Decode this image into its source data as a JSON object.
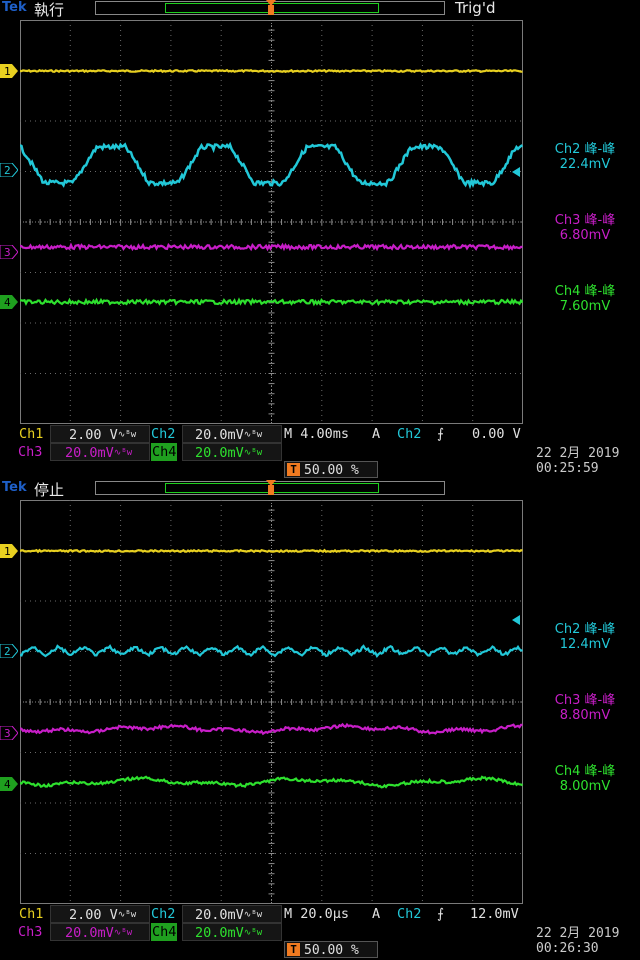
{
  "colors": {
    "ch1": "#e8d020",
    "ch2": "#22c8d8",
    "ch3": "#c81ec8",
    "ch4": "#2ee02e",
    "trigger": "#f07a20",
    "grid": "#6a6a6a",
    "brand": "#1e5fc8"
  },
  "captures": [
    {
      "brand": "Tek",
      "state": "執行",
      "trig_status": "Trig'd",
      "markers": [
        "1",
        "2",
        "3",
        "4"
      ],
      "measurements": [
        {
          "label": "Ch2 峰-峰",
          "value": "22.4mV"
        },
        {
          "label": "Ch3 峰-峰",
          "value": "6.80mV"
        },
        {
          "label": "Ch4 峰-峰",
          "value": "7.60mV"
        }
      ],
      "info": {
        "ch1_label": "Ch1",
        "ch1_scale": "2.00 V",
        "ch2_label": "Ch2",
        "ch2_scale": "20.0mV",
        "ch3_label": "Ch3",
        "ch3_scale": "20.0mV",
        "ch4_label": "Ch4",
        "ch4_scale": "20.0mV",
        "coupling": "∿ᴮw",
        "timebase": "M 4.00ms",
        "trig_mode": "A",
        "trig_source": "Ch2",
        "trig_slope": "⨍",
        "trig_level": "0.00 V",
        "trig_pos_icon": "T",
        "trig_pos": "50.00 %",
        "date": "22 2月  2019",
        "time": "00:25:59"
      }
    },
    {
      "brand": "Tek",
      "state": "停止",
      "trig_status": "",
      "markers": [
        "1",
        "2",
        "3",
        "4"
      ],
      "measurements": [
        {
          "label": "Ch2 峰-峰",
          "value": "12.4mV"
        },
        {
          "label": "Ch3 峰-峰",
          "value": "8.80mV"
        },
        {
          "label": "Ch4 峰-峰",
          "value": "8.00mV"
        }
      ],
      "info": {
        "ch1_label": "Ch1",
        "ch1_scale": "2.00 V",
        "ch2_label": "Ch2",
        "ch2_scale": "20.0mV",
        "ch3_label": "Ch3",
        "ch3_scale": "20.0mV",
        "ch4_label": "Ch4",
        "ch4_scale": "20.0mV",
        "coupling": "∿ᴮw",
        "timebase": "M 20.0µs",
        "trig_mode": "A",
        "trig_source": "Ch2",
        "trig_slope": "⨍",
        "trig_level": "12.0mV",
        "trig_pos_icon": "T",
        "trig_pos": "50.00 %",
        "date": "22 2月  2019",
        "time": "00:26:30"
      }
    }
  ]
}
